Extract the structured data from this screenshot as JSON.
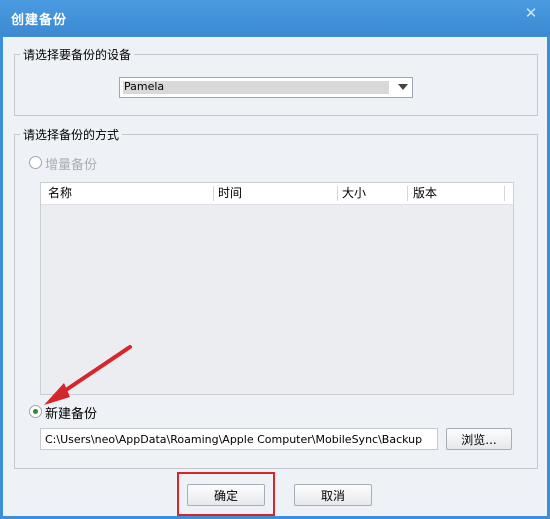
{
  "window": {
    "title": "创建备份",
    "close_glyph": "✕"
  },
  "device_group": {
    "title": "请选择要备份的设备",
    "selected_device": "Pamela"
  },
  "method_group": {
    "title": "请选择备份的方式",
    "incremental_label": "增量备份",
    "incremental_enabled": false,
    "columns": [
      "名称",
      "时间",
      "大小",
      "版本"
    ],
    "new_backup_label": "新建备份",
    "new_backup_selected": true,
    "path": "C:\\Users\\neo\\AppData\\Roaming\\Apple Computer\\MobileSync\\Backup",
    "browse_label": "浏览..."
  },
  "buttons": {
    "ok": "确定",
    "cancel": "取消"
  },
  "colors": {
    "title_bar": "#3b8ad3",
    "annotation_red": "#d7262a",
    "radio_checked": "#2e8b2e"
  }
}
